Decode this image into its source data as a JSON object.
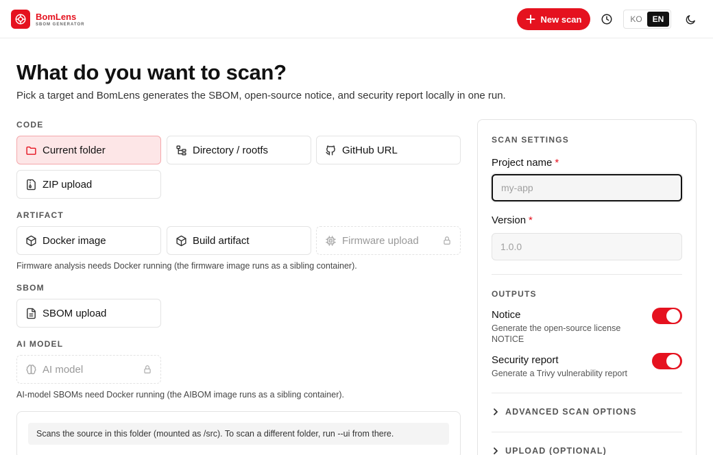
{
  "header": {
    "brand_name": "BomLens",
    "brand_sub": "SBOM GENERATOR",
    "new_scan_label": "New scan",
    "lang_ko": "KO",
    "lang_en": "EN",
    "active_lang": "EN"
  },
  "page": {
    "title": "What do you want to scan?",
    "subtitle": "Pick a target and BomLens generates the SBOM, open-source notice, and security report locally in one run."
  },
  "sections": {
    "code": {
      "label": "CODE",
      "items": [
        {
          "label": "Current folder",
          "icon": "folder-icon",
          "state": "selected"
        },
        {
          "label": "Directory / rootfs",
          "icon": "tree-icon",
          "state": "normal"
        },
        {
          "label": "GitHub URL",
          "icon": "github-icon",
          "state": "normal"
        },
        {
          "label": "ZIP upload",
          "icon": "zip-file-icon",
          "state": "normal"
        }
      ]
    },
    "artifact": {
      "label": "ARTIFACT",
      "items": [
        {
          "label": "Docker image",
          "icon": "package-icon",
          "state": "normal"
        },
        {
          "label": "Build artifact",
          "icon": "package-icon",
          "state": "normal"
        },
        {
          "label": "Firmware upload",
          "icon": "chip-icon",
          "state": "disabled"
        }
      ],
      "note": "Firmware analysis needs Docker running (the firmware image runs as a sibling container)."
    },
    "sbom": {
      "label": "SBOM",
      "items": [
        {
          "label": "SBOM upload",
          "icon": "file-icon",
          "state": "normal"
        }
      ]
    },
    "ai_model": {
      "label": "AI MODEL",
      "items": [
        {
          "label": "AI model",
          "icon": "brain-icon",
          "state": "disabled"
        }
      ],
      "note": "AI-model SBOMs need Docker running (the AIBOM image runs as a sibling container)."
    }
  },
  "info": {
    "text": "Scans the source in this folder (mounted as /src). To scan a different folder, run --ui from there."
  },
  "settings": {
    "title": "SCAN SETTINGS",
    "project_name_label": "Project name",
    "project_name_placeholder": "my-app",
    "project_name_value": "",
    "version_label": "Version",
    "version_placeholder": "1.0.0",
    "version_value": "",
    "required_mark": "*",
    "outputs_title": "OUTPUTS",
    "outputs": [
      {
        "title": "Notice",
        "desc": "Generate the open-source license NOTICE",
        "enabled": true
      },
      {
        "title": "Security report",
        "desc": "Generate a Trivy vulnerability report",
        "enabled": true
      }
    ],
    "advanced_label": "ADVANCED SCAN OPTIONS",
    "upload_label": "UPLOAD (OPTIONAL)"
  },
  "colors": {
    "accent": "#e5121f",
    "selected_bg": "#fde6e7",
    "selected_border": "#f4a7ab"
  }
}
